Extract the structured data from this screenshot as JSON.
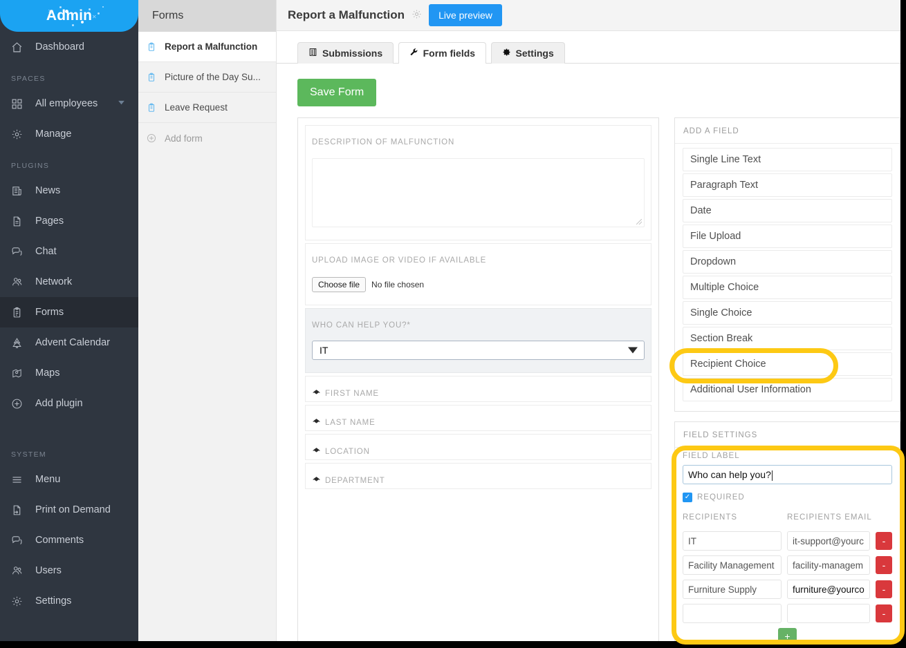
{
  "sidebar": {
    "logo": "Admin",
    "top_items": [
      {
        "label": "Dashboard",
        "icon": "home-icon"
      }
    ],
    "groups": [
      {
        "title": "SPACES",
        "items": [
          {
            "label": "All employees",
            "icon": "grid-icon",
            "caret": "▼"
          },
          {
            "label": "Manage",
            "icon": "gear-icon"
          }
        ]
      },
      {
        "title": "PLUGINS",
        "items": [
          {
            "label": "News",
            "icon": "newspaper-icon"
          },
          {
            "label": "Pages",
            "icon": "page-icon"
          },
          {
            "label": "Chat",
            "icon": "chat-icon"
          },
          {
            "label": "Network",
            "icon": "network-icon"
          },
          {
            "label": "Forms",
            "icon": "clipboard-icon",
            "active": true
          },
          {
            "label": "Advent Calendar",
            "icon": "tree-icon"
          },
          {
            "label": "Maps",
            "icon": "map-pin-icon"
          },
          {
            "label": "Add plugin",
            "icon": "plus-circle-icon"
          }
        ]
      },
      {
        "title": "SYSTEM",
        "items": [
          {
            "label": "Menu",
            "icon": "hamburger-icon"
          },
          {
            "label": "Print on Demand",
            "icon": "print-page-icon"
          },
          {
            "label": "Comments",
            "icon": "comments-icon"
          },
          {
            "label": "Users",
            "icon": "users-icon"
          },
          {
            "label": "Settings",
            "icon": "gear-icon"
          }
        ]
      }
    ]
  },
  "forms_column": {
    "header": "Forms",
    "items": [
      {
        "label": "Report a Malfunction",
        "selected": true
      },
      {
        "label": "Picture of the Day Su...",
        "selected": false
      },
      {
        "label": "Leave Request",
        "selected": false
      }
    ],
    "add_form": "Add form"
  },
  "topbar": {
    "title": "Report a Malfunction",
    "gear_icon": "gear-icon",
    "live_preview": "Live preview"
  },
  "tabs": [
    {
      "label": "Submissions",
      "icon": "list-icon",
      "active": false
    },
    {
      "label": "Form fields",
      "icon": "wrench-icon",
      "active": true
    },
    {
      "label": "Settings",
      "icon": "gear-icon",
      "active": false
    }
  ],
  "toolbar": {
    "save_label": "Save Form"
  },
  "form_fields": [
    {
      "label": "DESCRIPTION OF MALFUNCTION",
      "type": "paragraph"
    },
    {
      "label": "UPLOAD IMAGE OR VIDEO IF AVAILABLE",
      "type": "file",
      "choose_file": "Choose file",
      "no_file": "No file chosen"
    },
    {
      "label": "WHO CAN HELP YOU?*",
      "type": "dropdown",
      "value": "IT",
      "selected": true
    },
    {
      "label": "FIRST NAME",
      "type": "user-info"
    },
    {
      "label": "LAST NAME",
      "type": "user-info"
    },
    {
      "label": "LOCATION",
      "type": "user-info"
    },
    {
      "label": "DEPARTMENT",
      "type": "user-info"
    }
  ],
  "add_field_panel": {
    "title": "ADD A FIELD",
    "options": [
      "Single Line Text",
      "Paragraph Text",
      "Date",
      "File Upload",
      "Dropdown",
      "Multiple Choice",
      "Single Choice",
      "Section Break",
      "Recipient Choice",
      "Additional User Information"
    ],
    "highlighted_option": "Recipient Choice"
  },
  "field_settings": {
    "title": "FIELD SETTINGS",
    "field_label_caption": "FIELD LABEL",
    "field_label_value": "Who can help you?",
    "required_caption": "REQUIRED",
    "required_checked": true,
    "recipients_caption": "RECIPIENTS",
    "recipients_email_caption": "RECIPIENTS EMAIL",
    "rows": [
      {
        "name": "IT",
        "email": "it-support@yourc",
        "remove": "-"
      },
      {
        "name": "Facility Management",
        "email": "facility-managem",
        "remove": "-"
      },
      {
        "name": "Furniture Supply",
        "email": "furniture@yourco",
        "remove": "-"
      },
      {
        "name": "",
        "email": "",
        "remove": "-"
      }
    ],
    "add_row": "+"
  },
  "colors": {
    "sidebar_bg": "#2f3640",
    "logo_blue": "#1ba3f2",
    "accent_blue": "#2196f3",
    "save_green": "#5cb85c",
    "remove_red": "#d9383c",
    "add_green": "#66b266",
    "highlight_yellow": "#fdc914"
  }
}
